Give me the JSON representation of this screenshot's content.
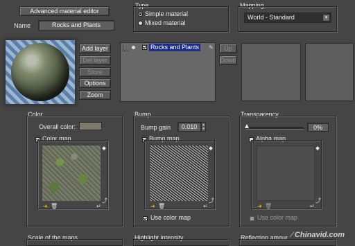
{
  "header": {
    "editor_title": "Advanced material editor",
    "name_label": "Name",
    "material_name": "Rocks and Plants"
  },
  "type_group": {
    "title": "Type",
    "options": [
      "Simple material",
      "Mixed material"
    ],
    "selected_index": 0
  },
  "mapping_group": {
    "title": "Mapping",
    "selected": "World - Standard"
  },
  "layer_buttons": {
    "add": "Add layer",
    "del": "Del layer",
    "store": "Store",
    "options": "Options",
    "zoom": "Zoom"
  },
  "layers": {
    "items": [
      {
        "label": "Rocks and Plants",
        "selected": true
      }
    ],
    "up": "Up",
    "down": "Down"
  },
  "color_group": {
    "title": "Color",
    "overall_label": "Overall color:",
    "map_label": "Color map",
    "map_checked": true
  },
  "bump_group": {
    "title": "Bump",
    "gain_label": "Bump gain",
    "gain_value": "0.010",
    "map_label": "Bump map",
    "map_checked": true,
    "use_color_map_label": "Use color map",
    "use_color_map_checked": true
  },
  "transparency_group": {
    "title": "Transparency",
    "slider_value": 0,
    "value_text": "0%",
    "map_label": "Alpha map",
    "map_checked": false,
    "use_color_map_label": "Use color map",
    "use_color_map_checked": false
  },
  "bottom_groups": {
    "scale": "Scale of the maps",
    "highlight": "Highlight intensity",
    "reflection": "Reflection amour"
  },
  "watermark": "Chinavid.com",
  "colors": {
    "background": "#454545",
    "selection": "#1c2e8a",
    "overall_color_swatch": "#7b7b6b"
  }
}
